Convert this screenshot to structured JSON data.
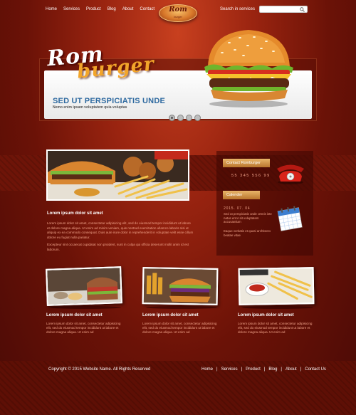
{
  "nav": {
    "items": [
      "Home",
      "Services",
      "Product",
      "Blog",
      "About",
      "Contact"
    ]
  },
  "logo": {
    "name": "Rom",
    "tagline": "burger"
  },
  "search": {
    "label": "Search in services",
    "placeholder": ""
  },
  "banner": {
    "brand_word1": "Rom",
    "brand_word2": "burger",
    "title": "SED UT PERSPICIATIS UNDE",
    "subtitle": "Nemo enim ipsam voluptatem quia voluptas",
    "slides": 4,
    "active_slide": 1
  },
  "main": {
    "heading": "Lorem ipsum dolor sit amet",
    "para1": "Lorem ipsum dolor sit amet, consectetur adipisicing elit, sed do eiusmod tempor incididunt ut labore et dolore magna aliqua. Ut enim ad minim veniam, quis nostrud exercitation ullamco laboris nisi ut aliquip ex ea commodo consequat. Duis aute irure dolor in reprehenderit in voluptate velit esse cillum dolore eu fugiat nulla pariatur.",
    "para2": "Excepteur sint occaecat cupidatat non proident, sunt in culpa qui officia deserunt mollit anim id est laborum."
  },
  "sidebar": {
    "contact_title": "Contact Romburger",
    "phone": "55 345 556 99",
    "calendar_title": "Calender",
    "date": "2015. 07. 04",
    "cal_text1": "Sed ut perspiciatis unde omnis iste natus error sit voluptatem accusantium",
    "cal_text2": "Eaque veritatis et quasi architecto beatae vitae"
  },
  "cards": [
    {
      "heading": "Lorem ipsum dolor sit amet",
      "text": "Lorem ipsum dolor sit amet, consectetur adipisicing elit, sed do eiusmod tempor incididunt ut labore et dolore magna aliqua. Ut enim ad"
    },
    {
      "heading": "Lorem ipsum dolor sit amet",
      "text": "Lorem ipsum dolor sit amet, consectetur adipisicing elit, sed do eiusmod tempor incididunt ut labore et dolore magna aliqua. Ut enim ad"
    },
    {
      "heading": "Lorem ipsum dolor sit amet",
      "text": "Lorem ipsum dolor sit amet, consectetur adipisicing elit, sed do eiusmod tempor incididunt ut labore et dolore magna aliqua. Ut enim ad"
    }
  ],
  "footer": {
    "copyright": "Copyright © 2015 Website Name. All Rights Reserved",
    "links": [
      "Home",
      "Services",
      "Product",
      "Blog",
      "About",
      "Contact Us"
    ],
    "separator": "|"
  },
  "colors": {
    "accent": "#2f6aa0",
    "text_muted": "#f0a38a",
    "gold": "#e9b66a",
    "background": "#6b1207"
  }
}
